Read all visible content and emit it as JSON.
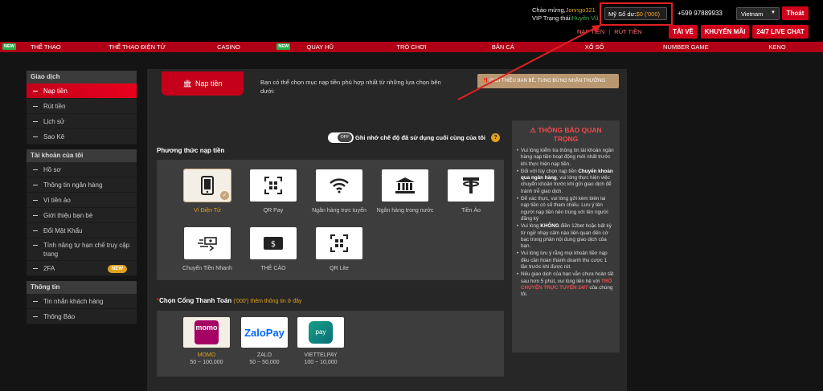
{
  "header": {
    "welcome_prefix": "Chào mừng,",
    "username": "Jonngo321",
    "vip_prefix": "VIP Trạng thái:",
    "vip_level": "Huyền Vũ",
    "balance_label": "Mỹ Số dư:",
    "balance_amount": "$0 ('000)",
    "hotline": "+599 97889933",
    "language": "Vietnam",
    "logout": "Thoát",
    "deposit_link": "NẠP TIỀN",
    "withdraw_link": "RÚT TIỀN",
    "download": "TẢI VỀ",
    "promo": "KHUYẾN MÃI",
    "live_chat": "24/7 LIVE CHAT"
  },
  "nav": {
    "new_badge": "NEW",
    "items": [
      "THỂ THAO",
      "THỂ THAO ĐIỆN TỬ",
      "CASINO",
      "QUAY HŨ",
      "TRÒ CHƠI",
      "BẮN CÁ",
      "XỔ SỐ",
      "NUMBER GAME",
      "KENO"
    ]
  },
  "sidebar": {
    "groups": [
      {
        "title": "Giao dịch",
        "items": [
          "Nạp tiền",
          "Rút tiền",
          "Lịch sử",
          "Sao Kê"
        ]
      },
      {
        "title": "Tài khoản của tôi",
        "items": [
          "Hồ sơ",
          "Thông tin ngân hàng",
          "Ví tiền ảo",
          "Giới thiệu bạn bè",
          "Đổi Mật Khẩu",
          "Tính năng tự hạn chế truy cập trang",
          "2FA"
        ]
      },
      {
        "title": "Thông tin",
        "items": [
          "Tin nhắn khách hàng",
          "Thông Báo"
        ]
      }
    ],
    "badge_2fa": "NEW"
  },
  "main": {
    "tab_label": "Nạp tiền",
    "intro": "Bạn có thể chọn mục nạp tiền phù hợp nhất từ những lựa chọn bên dưới:",
    "invite_banner": "GIỚI THIỆU BẠN BÈ, TUNG BỪNG NHẬN THƯỞNG",
    "toggle_off": "OFF",
    "remember_label": "Ghi nhớ chế độ đã sử dụng cuối cùng của tôi",
    "methods_title": "Phương thức nạp tiền",
    "methods": [
      "Ví Điện Tử",
      "QR Pay",
      "Ngân hàng trực tuyến",
      "Ngân hàng trong nước",
      "Tiền Ảo",
      "Chuyển Tiền Nhanh",
      "THẺ CÀO",
      "QR Lite"
    ],
    "gateway_title": "Chọn Cổng Thanh Toán",
    "gateway_note": "('000') thêm thông tin ở đây",
    "gateways": [
      {
        "name": "MOMO",
        "range": "50 ~ 100,000",
        "logo": "momo"
      },
      {
        "name": "ZALO",
        "range": "50 ~ 50,000",
        "logo": "ZaloPay"
      },
      {
        "name": "VIETTELPAY",
        "range": "100 ~ 10,000",
        "logo": "pay"
      }
    ]
  },
  "notice": {
    "title": "THÔNG BÁO QUAN TRỌNG",
    "items": [
      {
        "parts": [
          {
            "t": "Vui lòng kiểm tra thông tin tài khoản ngân hàng nạp tiền hoạt động mới nhất trước khi thực hiện nạp tiền.",
            "s": ""
          }
        ]
      },
      {
        "parts": [
          {
            "t": "Đối với tùy chọn nạp tiền ",
            "s": ""
          },
          {
            "t": "Chuyển khoản qua ngân hàng",
            "s": "b"
          },
          {
            "t": ", vui lòng thực hiện việc chuyển khoản trước khi gửi giao dịch để tránh trễ giao dịch.",
            "s": ""
          }
        ]
      },
      {
        "parts": [
          {
            "t": "Để xác thực, vui lòng gửi kèm biên lai nạp tiền có số tham chiếu. Lưu ý tên người nạp tiền nên trùng với tên người đăng ký",
            "s": ""
          }
        ]
      },
      {
        "parts": [
          {
            "t": "Vui lòng ",
            "s": ""
          },
          {
            "t": "KHÔNG",
            "s": "b"
          },
          {
            "t": " điền 12bet hoặc bất kỳ từ ngữ nhạy cảm nào liên quan đến cờ bạc trong phần nội dung giao dịch của bạn.",
            "s": ""
          }
        ]
      },
      {
        "parts": [
          {
            "t": "Vui lòng lưu ý rằng mọi khoản tiền nạp đều cần hoàn thành doanh thu cược 1 lần trước khi được rút.",
            "s": ""
          }
        ]
      },
      {
        "parts": [
          {
            "t": "Nếu giao dịch của bạn vẫn chưa hoàn tất sau hơn 5 phút, vui lòng liên hệ với ",
            "s": ""
          },
          {
            "t": "TRÒ CHUYỆN TRỰC TUYẾN 24/7",
            "s": "r"
          },
          {
            "t": " của chúng tôi.",
            "s": ""
          }
        ]
      }
    ]
  },
  "colors": {
    "brand_red": "#d0021b",
    "gold": "#e0a11b",
    "annotation": "#e02020"
  }
}
